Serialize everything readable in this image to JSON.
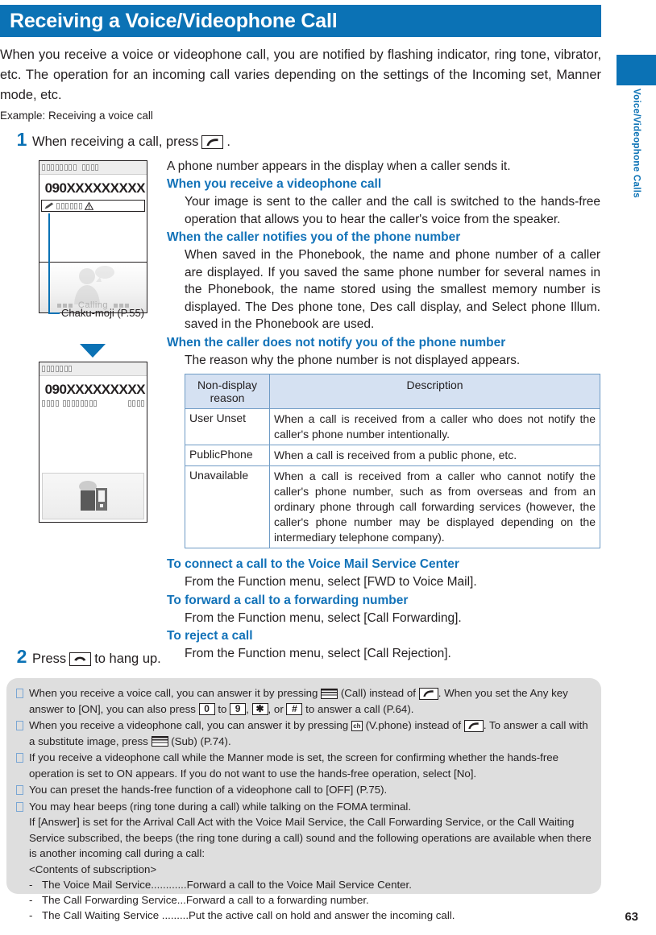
{
  "header": {
    "title": "Receiving a Voice/Videophone Call",
    "accent_color": "#0b72b5"
  },
  "side_tab": {
    "label": "Voice/Videophone Calls"
  },
  "intro": {
    "paragraph": "When you receive a voice or videophone call, you are notified by flashing indicator, ring tone, vibrator, etc. The operation for an incoming call varies depending on the settings of the Incoming set, Manner mode, etc.",
    "example": "Example: Receiving a voice call"
  },
  "steps": [
    {
      "number": "1",
      "text_before": "When receiving a call, press",
      "key": "call-key",
      "text_after": "."
    },
    {
      "number": "2",
      "text_before": "Press",
      "key": "end-key",
      "text_after": "to hang up."
    }
  ],
  "figure": {
    "screen1": {
      "number": "090XXXXXXXXX",
      "calling_label": "Calling",
      "chaku_band_icons": [
        "pencil-icon",
        "warning-icon"
      ]
    },
    "screen2": {
      "number": "090XXXXXXXXX"
    },
    "callout": "Chaku-moji (P.55)"
  },
  "main": {
    "lead": "A phone number appears in the display when a caller sends it.",
    "sections": [
      {
        "heading": "When you receive a videophone call",
        "body": "Your image is sent to the caller and the call is switched to the hands-free operation that allows you to hear the caller's voice from the speaker."
      },
      {
        "heading": "When the caller notifies you of the phone number",
        "body": "When saved in the Phonebook, the name and phone number of a caller are displayed. If you saved the same phone number for several names in the Phonebook, the name stored using the smallest memory number is displayed. The Des phone tone, Des call display, and Select phone Illum. saved in the Phonebook are used."
      },
      {
        "heading": "When the caller does not notify you of the phone number",
        "body": "The reason why the phone number is not displayed appears."
      }
    ],
    "table": {
      "headers": [
        "Non-display reason",
        "Description"
      ],
      "rows": [
        {
          "reason": "User Unset",
          "description": "When a call is received from a caller who does not notify the caller's phone number intentionally."
        },
        {
          "reason": "PublicPhone",
          "description": "When a call is received from a public phone, etc."
        },
        {
          "reason": "Unavailable",
          "description": "When a call is received from a caller who cannot notify the caller's phone number, such as from overseas and from an ordinary phone through call forwarding services (however, the caller's phone number may be displayed depending on the intermediary telephone company)."
        }
      ]
    },
    "post_sections": [
      {
        "heading": "To connect a call to the Voice Mail Service Center",
        "body": "From the Function menu, select [FWD to Voice Mail]."
      },
      {
        "heading": "To forward a call to a forwarding number",
        "body": "From the Function menu, select [Call Forwarding]."
      },
      {
        "heading": "To reject a call",
        "body": "From the Function menu, select [Call Rejection]."
      }
    ]
  },
  "notes": {
    "note1": {
      "a": "When you receive a voice call, you can answer it by pressing",
      "b": "(Call) instead of",
      "c": ". When you set the Any key answer to [ON], you can also press",
      "key0": "0",
      "to": "to",
      "key9": "9",
      "comma1": ",",
      "keystar": "✱",
      "orword": ", or",
      "keyhash": "#",
      "d": "to answer a call (P.64)."
    },
    "note2": {
      "a": "When you receive a videophone call, you can answer it by pressing",
      "vkey": "ch",
      "b": "(V.phone) instead of",
      "c": ". To answer a call with a substitute image, press",
      "d": "(Sub) (P.74)."
    },
    "note3": "If you receive a videophone call while the Manner mode is set, the screen for confirming whether the hands-free operation is set to ON appears. If you do not want to use the hands-free operation, select [No].",
    "note4": "You can preset the hands-free function of a videophone call to [OFF] (P.75).",
    "note5": {
      "line1": "You may hear beeps (ring tone during a call) while talking on the FOMA terminal.",
      "line2": "If [Answer] is set for the Arrival Call Act with the Voice Mail Service, the Call Forwarding Service, or the Call Waiting Service subscribed, the beeps (the ring tone during a call) sound and the following operations are available when there is another incoming call during a call:",
      "line3": "<Contents of subscription>",
      "items": [
        {
          "name": "The Voice Mail Service............",
          "desc": "Forward a call to the Voice Mail Service Center."
        },
        {
          "name": "The Call Forwarding Service...",
          "desc": "Forward a call to a forwarding number."
        },
        {
          "name": "The Call Waiting Service .........",
          "desc": "Put the active call on hold and answer the incoming call."
        }
      ]
    }
  },
  "footer": {
    "page_number": "63"
  }
}
